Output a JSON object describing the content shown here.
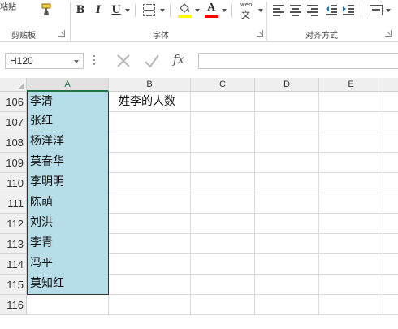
{
  "ribbon": {
    "paste_label": "粘贴",
    "groups": [
      {
        "label": "剪贴板"
      },
      {
        "label": "字体"
      },
      {
        "label": "对齐方式"
      }
    ],
    "font_buttons": {
      "bold": "B",
      "italic": "I",
      "underline": "U"
    },
    "font_color_letter": "A",
    "phonetic_top": "wén",
    "phonetic_bottom": "文",
    "fill_color": "#ffff00",
    "font_color": "#ff0000"
  },
  "formula_bar": {
    "name_box": "H120",
    "fx_label": "fx",
    "formula": ""
  },
  "sheet": {
    "columns": [
      "A",
      "B",
      "C",
      "D",
      "E"
    ],
    "rows": [
      {
        "num": "106",
        "a": "李清",
        "b": "姓李的人数"
      },
      {
        "num": "107",
        "a": "张红",
        "b": ""
      },
      {
        "num": "108",
        "a": "杨洋洋",
        "b": ""
      },
      {
        "num": "109",
        "a": "莫春华",
        "b": ""
      },
      {
        "num": "110",
        "a": "李明明",
        "b": ""
      },
      {
        "num": "111",
        "a": "陈萌",
        "b": ""
      },
      {
        "num": "112",
        "a": "刘洪",
        "b": ""
      },
      {
        "num": "113",
        "a": "李青",
        "b": ""
      },
      {
        "num": "114",
        "a": "冯平",
        "b": ""
      },
      {
        "num": "115",
        "a": "莫知红",
        "b": ""
      },
      {
        "num": "116",
        "a": "",
        "b": ""
      }
    ],
    "name_cell_color": "#b7dde8",
    "accent_color": "#217346"
  }
}
